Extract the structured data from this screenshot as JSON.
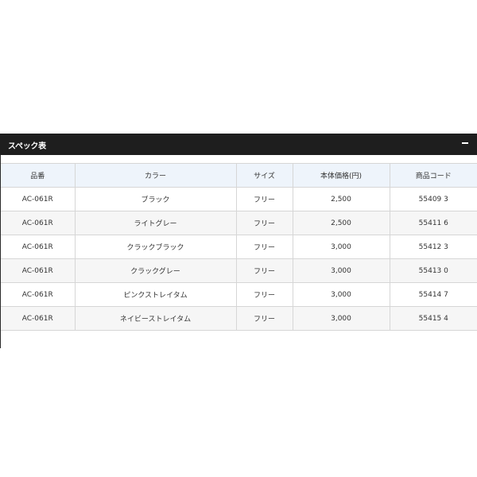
{
  "panel": {
    "title": "スペック表",
    "collapse_icon": "minus-icon"
  },
  "table": {
    "headers": [
      "品番",
      "カラー",
      "サイズ",
      "本体価格(円)",
      "商品コード"
    ],
    "rows": [
      [
        "AC-061R",
        "ブラック",
        "フリー",
        "2,500",
        "55409 3"
      ],
      [
        "AC-061R",
        "ライトグレー",
        "フリー",
        "2,500",
        "55411 6"
      ],
      [
        "AC-061R",
        "クラックブラック",
        "フリー",
        "3,000",
        "55412 3"
      ],
      [
        "AC-061R",
        "クラックグレー",
        "フリー",
        "3,000",
        "55413 0"
      ],
      [
        "AC-061R",
        "ピンクストレイタム",
        "フリー",
        "3,000",
        "55414 7"
      ],
      [
        "AC-061R",
        "ネイビーストレイタム",
        "フリー",
        "3,000",
        "55415 4"
      ]
    ]
  },
  "colors": {
    "header_bar": "#1e1e1e",
    "table_header_bg": "#eef4fb",
    "row_alt_bg": "#f6f6f6",
    "border": "#d6d6d6"
  }
}
